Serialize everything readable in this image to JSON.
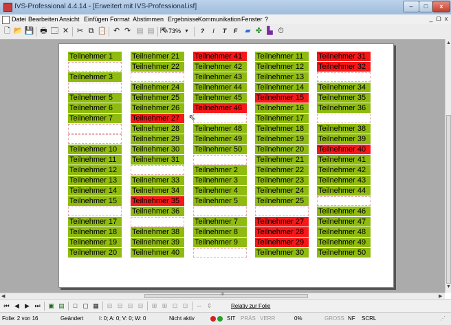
{
  "window": {
    "title": "IVS-Professional 4.4.14 - [Erweitert mit IVS-Professional.isf]",
    "min_label": "‒",
    "max_label": "□",
    "close_label": "x",
    "mdi_min": "_",
    "mdi_restore": "ᗝ",
    "mdi_close": "x"
  },
  "menu": {
    "items": [
      "Datei",
      "Bearbeiten",
      "Ansicht",
      "Einfügen",
      "Format",
      "Abstimmen",
      "Ergebnisse",
      "Kommunikation",
      "Fenster",
      "?"
    ]
  },
  "toolbar": {
    "zoom": "73%",
    "text_buttons": [
      "?",
      "I",
      "T",
      "F"
    ]
  },
  "grid": {
    "columns": [
      [
        {
          "label": "Teilnehmer 1",
          "color": "green"
        },
        {
          "label": "",
          "color": "empty"
        },
        {
          "label": "Teilnehmer 3",
          "color": "green"
        },
        {
          "label": "",
          "color": "empty"
        },
        {
          "label": "Teilnehmer 5",
          "color": "green"
        },
        {
          "label": "Teilnehmer 6",
          "color": "green"
        },
        {
          "label": "Teilnehmer 7",
          "color": "green"
        },
        {
          "label": "",
          "color": "empty"
        },
        {
          "label": "",
          "color": "empty"
        },
        {
          "label": "Teilnehmer 10",
          "color": "green"
        },
        {
          "label": "Teilnehmer 11",
          "color": "green"
        },
        {
          "label": "Teilnehmer 12",
          "color": "green"
        },
        {
          "label": "Teilnehmer 13",
          "color": "green"
        },
        {
          "label": "Teilnehmer 14",
          "color": "green"
        },
        {
          "label": "Teilnehmer 15",
          "color": "green"
        },
        {
          "label": "",
          "color": "empty"
        },
        {
          "label": "Teilnehmer 17",
          "color": "green"
        },
        {
          "label": "Teilnehmer 18",
          "color": "green"
        },
        {
          "label": "Teilnehmer 19",
          "color": "green"
        },
        {
          "label": "Teilnehmer 20",
          "color": "green"
        }
      ],
      [
        {
          "label": "Teilnehmer 21",
          "color": "green"
        },
        {
          "label": "Teilnehmer 22",
          "color": "green"
        },
        {
          "label": "",
          "color": "empty"
        },
        {
          "label": "Teilnehmer 24",
          "color": "green"
        },
        {
          "label": "Teilnehmer 25",
          "color": "green"
        },
        {
          "label": "Teilnehmer 26",
          "color": "green"
        },
        {
          "label": "Teilnehmer 27",
          "color": "red"
        },
        {
          "label": "Teilnehmer 28",
          "color": "green"
        },
        {
          "label": "Teilnehmer 29",
          "color": "green"
        },
        {
          "label": "Teilnehmer 30",
          "color": "green"
        },
        {
          "label": "Teilnehmer 31",
          "color": "green"
        },
        {
          "label": "",
          "color": "empty"
        },
        {
          "label": "Teilnehmer 33",
          "color": "green"
        },
        {
          "label": "Teilnehmer 34",
          "color": "green"
        },
        {
          "label": "Teilnehmer 35",
          "color": "red"
        },
        {
          "label": "Teilnehmer 36",
          "color": "green"
        },
        {
          "label": "",
          "color": "empty"
        },
        {
          "label": "Teilnehmer 38",
          "color": "green"
        },
        {
          "label": "Teilnehmer 39",
          "color": "green"
        },
        {
          "label": "Teilnehmer 40",
          "color": "green"
        }
      ],
      [
        {
          "label": "Teilnehmer 41",
          "color": "red"
        },
        {
          "label": "Teilnehmer 42",
          "color": "green"
        },
        {
          "label": "Teilnehmer 43",
          "color": "green"
        },
        {
          "label": "Teilnehmer 44",
          "color": "green"
        },
        {
          "label": "Teilnehmer 45",
          "color": "green"
        },
        {
          "label": "Teilnehmer 46",
          "color": "red"
        },
        {
          "label": "",
          "color": "empty"
        },
        {
          "label": "Teilnehmer 48",
          "color": "green"
        },
        {
          "label": "Teilnehmer 49",
          "color": "green"
        },
        {
          "label": "Teilnehmer 50",
          "color": "green"
        },
        {
          "label": "",
          "color": "empty"
        },
        {
          "label": "Teilnehmer 2",
          "color": "green"
        },
        {
          "label": "Teilnehmer 3",
          "color": "green"
        },
        {
          "label": "Teilnehmer 4",
          "color": "green"
        },
        {
          "label": "Teilnehmer 5",
          "color": "green"
        },
        {
          "label": "",
          "color": "empty"
        },
        {
          "label": "Teilnehmer 7",
          "color": "green"
        },
        {
          "label": "Teilnehmer 8",
          "color": "green"
        },
        {
          "label": "Teilnehmer 9",
          "color": "green"
        },
        {
          "label": "",
          "color": "empty"
        }
      ],
      [
        {
          "label": "Teilnehmer 11",
          "color": "green"
        },
        {
          "label": "Teilnehmer 12",
          "color": "green"
        },
        {
          "label": "Teilnehmer 13",
          "color": "green"
        },
        {
          "label": "Teilnehmer 14",
          "color": "green"
        },
        {
          "label": "Teilnehmer 15",
          "color": "red"
        },
        {
          "label": "Teilnehmer 16",
          "color": "green"
        },
        {
          "label": "Teilnehmer 17",
          "color": "green"
        },
        {
          "label": "Teilnehmer 18",
          "color": "green"
        },
        {
          "label": "Teilnehmer 19",
          "color": "green"
        },
        {
          "label": "Teilnehmer 20",
          "color": "green"
        },
        {
          "label": "Teilnehmer 21",
          "color": "green"
        },
        {
          "label": "Teilnehmer 22",
          "color": "green"
        },
        {
          "label": "Teilnehmer 23",
          "color": "green"
        },
        {
          "label": "Teilnehmer 24",
          "color": "green"
        },
        {
          "label": "Teilnehmer 25",
          "color": "green"
        },
        {
          "label": "",
          "color": "empty"
        },
        {
          "label": "Teilnehmer 27",
          "color": "red"
        },
        {
          "label": "Teilnehmer 28",
          "color": "red"
        },
        {
          "label": "Teilnehmer 29",
          "color": "red"
        },
        {
          "label": "Teilnehmer 30",
          "color": "green"
        }
      ],
      [
        {
          "label": "Teilnehmer 31",
          "color": "red"
        },
        {
          "label": "Teilnehmer 32",
          "color": "red"
        },
        {
          "label": "",
          "color": "empty"
        },
        {
          "label": "Teilnehmer 34",
          "color": "green"
        },
        {
          "label": "Teilnehmer 35",
          "color": "green"
        },
        {
          "label": "Teilnehmer 36",
          "color": "green"
        },
        {
          "label": "",
          "color": "empty"
        },
        {
          "label": "Teilnehmer 38",
          "color": "green"
        },
        {
          "label": "Teilnehmer 39",
          "color": "green"
        },
        {
          "label": "Teilnehmer 40",
          "color": "red"
        },
        {
          "label": "Teilnehmer 41",
          "color": "green"
        },
        {
          "label": "Teilnehmer 42",
          "color": "green"
        },
        {
          "label": "Teilnehmer 43",
          "color": "green"
        },
        {
          "label": "Teilnehmer 44",
          "color": "green"
        },
        {
          "label": "",
          "color": "empty"
        },
        {
          "label": "Teilnehmer 46",
          "color": "green"
        },
        {
          "label": "Teilnehmer 47",
          "color": "green"
        },
        {
          "label": "Teilnehmer 48",
          "color": "green"
        },
        {
          "label": "Teilnehmer 49",
          "color": "green"
        },
        {
          "label": "Teilnehmer 50",
          "color": "green"
        }
      ]
    ]
  },
  "navbar": {
    "relativ_label": "Relativ zur Folie",
    "hscroll_grip": "III"
  },
  "status": {
    "folie": "Folie: 2 von 16",
    "geaendert": "Geändert",
    "counters": "I: 0;  A: 0;  V: 0;  W: 0",
    "nicht_aktiv": "Nicht aktiv",
    "sit": "SIT",
    "praes": "PRÄS",
    "verr": "VERR",
    "percent": "0%",
    "gross": "GROSS",
    "nf": "NF",
    "scrl": "SCRL"
  },
  "colors": {
    "green": "#8fbb10",
    "red": "#f51818",
    "status_dot_red": "#d42020",
    "status_dot_green": "#2aa02a"
  }
}
